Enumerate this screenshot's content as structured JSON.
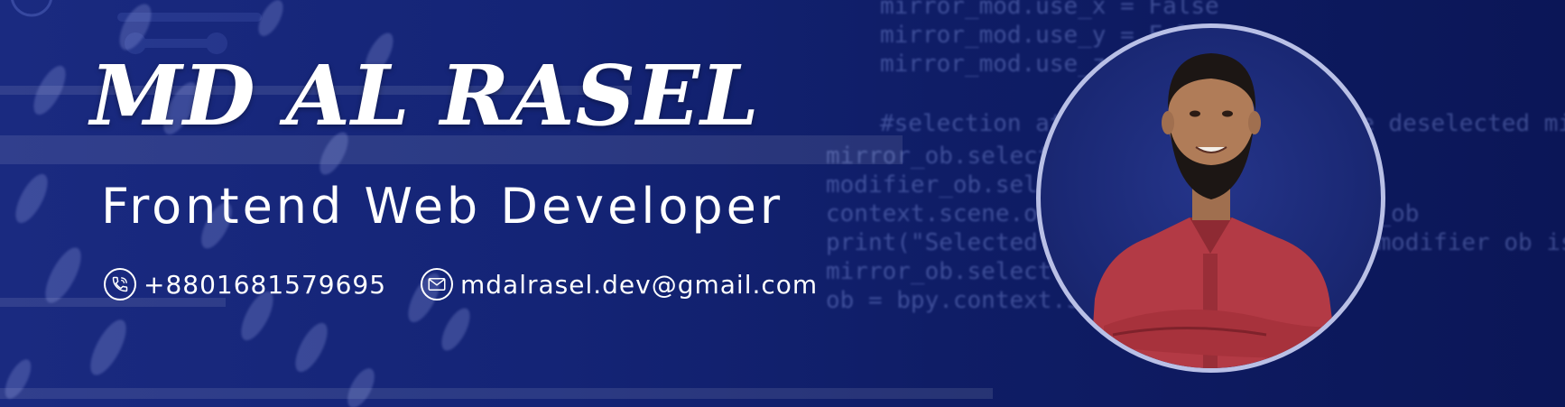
{
  "banner": {
    "name": "MD AL RASEL",
    "role": "Frontend Web Developer",
    "phone": "+8801681579695",
    "email": "mdalrasel.dev@gmail.com"
  },
  "background_code": [
    "mirror_mod.use_x = False",
    "mirror_mod.use_y = False",
    "mirror_mod.use_z = True",
    "#selection at the end -add back the deselected mirror",
    "mirror_ob.select= 1",
    "modifier_ob.select=1",
    "context.scene.objects.active = modifier_ob",
    "print(\"Selected\" + str(modifier_ob)) # modifier ob is",
    "mirror_ob.select = 0",
    "ob = bpy.context.selected_objects[0]"
  ],
  "icons": {
    "phone": "phone-icon",
    "email": "envelope-icon"
  },
  "colors": {
    "background": "#142476",
    "text": "#ffffff",
    "portrait_ring": "#b9c0e6",
    "shirt": "#b33a45"
  }
}
